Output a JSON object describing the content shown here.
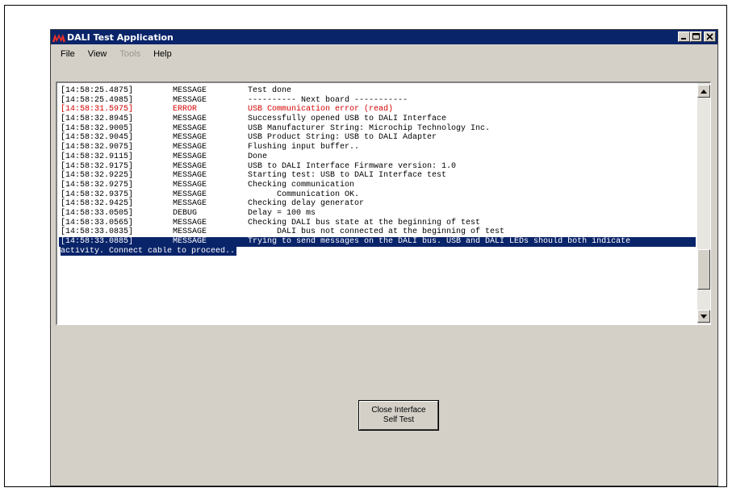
{
  "window": {
    "title": "DALI Test Application",
    "logo_icon": "microchip-logo-icon",
    "controls": {
      "minimize_icon": "minimize-icon",
      "maximize_icon": "maximize-icon",
      "close_icon": "close-icon"
    }
  },
  "menu": {
    "items": [
      {
        "label": "File",
        "enabled": true
      },
      {
        "label": "View",
        "enabled": true
      },
      {
        "label": "Tools",
        "enabled": false
      },
      {
        "label": "Help",
        "enabled": true
      }
    ]
  },
  "log": {
    "rows": [
      {
        "time": "[14:58:25.4875]",
        "level": "MESSAGE",
        "text": "Test done",
        "style": "normal"
      },
      {
        "time": "[14:58:25.4985]",
        "level": "MESSAGE",
        "text": "---------- Next board -----------",
        "style": "normal"
      },
      {
        "time": "[14:58:31.5975]",
        "level": "ERROR",
        "text": "USB Communication error (read)",
        "style": "error"
      },
      {
        "time": "[14:58:32.8945]",
        "level": "MESSAGE",
        "text": "Successfully opened USB to DALI Interface",
        "style": "normal"
      },
      {
        "time": "[14:58:32.9005]",
        "level": "MESSAGE",
        "text": "USB Manufacturer String: Microchip Technology Inc.",
        "style": "normal"
      },
      {
        "time": "[14:58:32.9045]",
        "level": "MESSAGE",
        "text": "USB Product String: USB to DALI Adapter",
        "style": "normal"
      },
      {
        "time": "[14:58:32.9075]",
        "level": "MESSAGE",
        "text": "Flushing input buffer..",
        "style": "normal"
      },
      {
        "time": "[14:58:32.9115]",
        "level": "MESSAGE",
        "text": "Done",
        "style": "normal"
      },
      {
        "time": "[14:58:32.9175]",
        "level": "MESSAGE",
        "text": "USB to DALI Interface Firmware version: 1.0",
        "style": "normal"
      },
      {
        "time": "[14:58:32.9225]",
        "level": "MESSAGE",
        "text": "Starting test: USB to DALI Interface test",
        "style": "normal"
      },
      {
        "time": "[14:58:32.9275]",
        "level": "MESSAGE",
        "text": "Checking communication",
        "style": "normal"
      },
      {
        "time": "[14:58:32.9375]",
        "level": "MESSAGE",
        "text": "      Communication OK.",
        "style": "normal"
      },
      {
        "time": "[14:58:32.9425]",
        "level": "MESSAGE",
        "text": "Checking delay generator",
        "style": "normal"
      },
      {
        "time": "[14:58:33.0505]",
        "level": "DEBUG",
        "text": "Delay = 100 ms",
        "style": "normal"
      },
      {
        "time": "[14:58:33.0565]",
        "level": "MESSAGE",
        "text": "Checking DALI bus state at the beginning of test",
        "style": "normal"
      },
      {
        "time": "[14:58:33.0835]",
        "level": "MESSAGE",
        "text": "      DALI bus not connected at the beginning of test",
        "style": "normal"
      },
      {
        "time": "[14:58:33.0885]",
        "level": "MESSAGE",
        "text": "Trying to send messages on the DALI bus. USB and DALI LEDs should both indicate",
        "style": "selected"
      }
    ],
    "wrap_text": "activity. Connect cable to proceed..",
    "scrollbar": {
      "up_icon": "scroll-up-arrow-icon",
      "down_icon": "scroll-down-arrow-icon"
    }
  },
  "actions": {
    "close_button_line1": "Close Interface",
    "close_button_line2": "Self Test"
  },
  "colors": {
    "titlebar": "#0a246a",
    "window_bg": "#d4d0c8",
    "error_text": "#d40000",
    "selection_bg": "#0a246a"
  }
}
